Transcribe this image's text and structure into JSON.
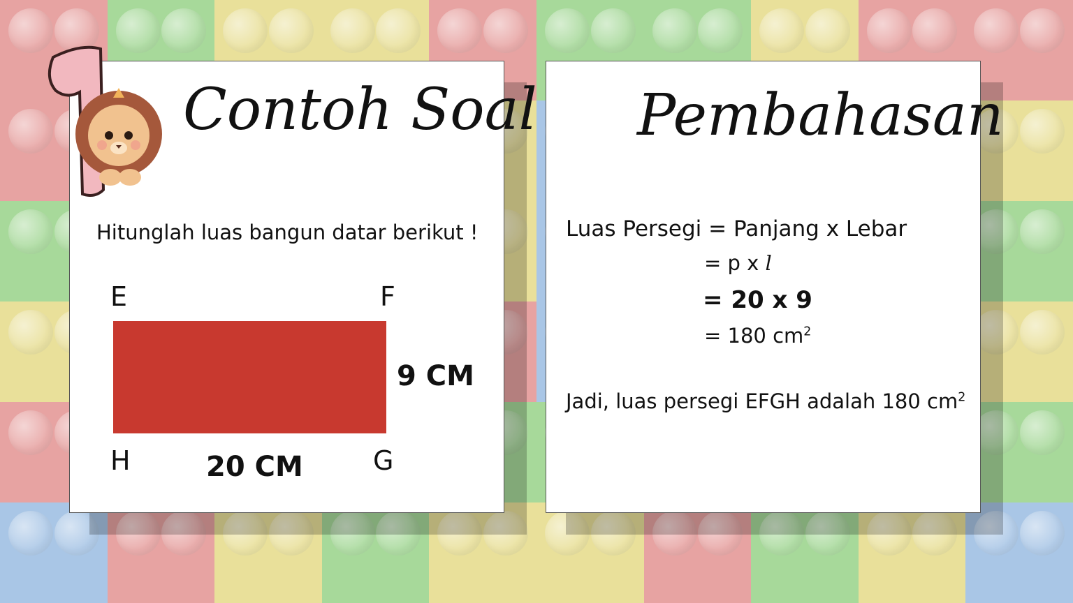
{
  "colors": {
    "rectangle": "#c8392f",
    "tiles": [
      "#e7a3a2",
      "#a7d99a",
      "#e9e09a",
      "#a9c6e6"
    ]
  },
  "badge": {
    "number": "1"
  },
  "left_card": {
    "title": "Contoh Soal",
    "question": "Hitunglah luas bangun datar berikut !",
    "vertices": {
      "e": "E",
      "f": "F",
      "g": "G",
      "h": "H"
    },
    "height_label": "9 CM",
    "width_label": "20 CM"
  },
  "right_card": {
    "title": "Pembahasan",
    "line1": "Luas Persegi = Panjang x Lebar",
    "line2": "= p x ",
    "line2_l": "l",
    "line3": "= 20 x 9",
    "line4": "= 180 cm",
    "line4_sup": "2",
    "conclusion": "Jadi, luas persegi EFGH adalah 180 cm",
    "conclusion_sup": "2"
  }
}
